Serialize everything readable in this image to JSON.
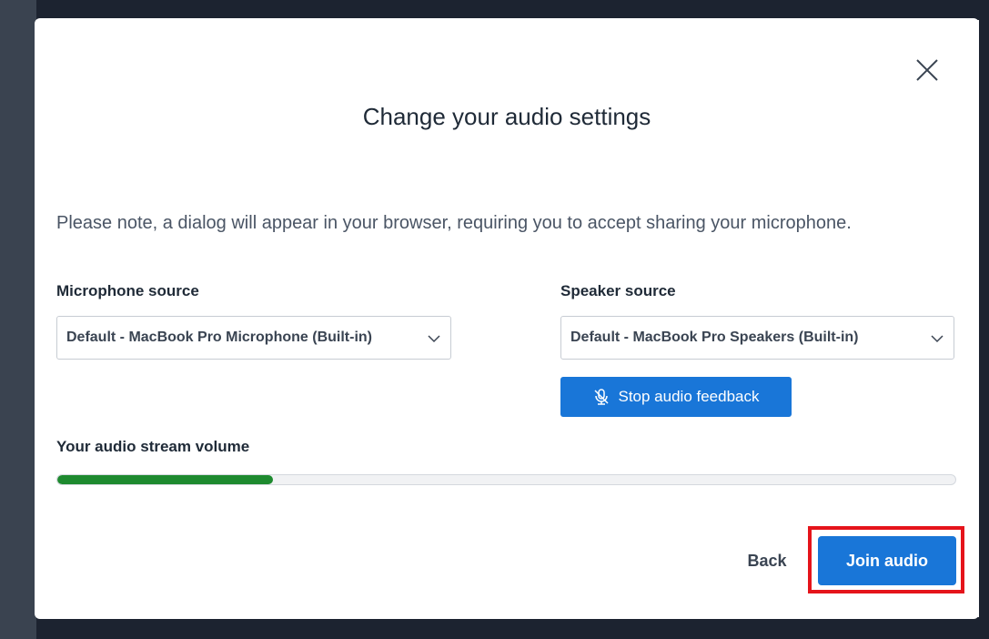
{
  "dialog": {
    "title": "Change your audio settings",
    "note": "Please note, a dialog will appear in your browser, requiring you to accept sharing your microphone.",
    "close_icon": "close-icon"
  },
  "microphone": {
    "label": "Microphone source",
    "selected": "Default - MacBook Pro Microphone (Built-in)"
  },
  "speaker": {
    "label": "Speaker source",
    "selected": "Default - MacBook Pro Speakers (Built-in)",
    "feedback_button": "Stop audio feedback",
    "feedback_icon": "microphone-muted-icon"
  },
  "volume": {
    "label": "Your audio stream volume",
    "level_fraction": 0.24,
    "fill_color": "#1e8a2f"
  },
  "footer": {
    "back_label": "Back",
    "join_label": "Join audio"
  },
  "colors": {
    "primary": "#1976d8",
    "highlight": "#e5141b"
  }
}
